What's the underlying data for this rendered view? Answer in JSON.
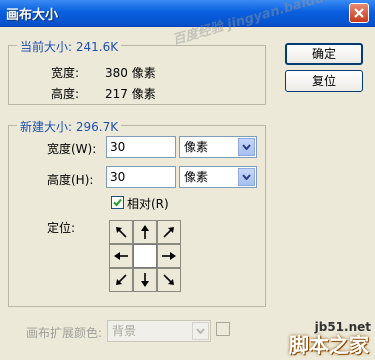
{
  "window": {
    "title": "画布大小"
  },
  "watermark": "百度经验 jingyan.baidu.com",
  "current_size": {
    "legend": "当前大小: 241.6K",
    "width_label": "宽度:",
    "width_value": "380 像素",
    "height_label": "高度:",
    "height_value": "217 像素"
  },
  "new_size": {
    "legend": "新建大小: 296.7K",
    "width_label": "宽度(W):",
    "width_value": "30",
    "width_unit": "像素",
    "height_label": "高度(H):",
    "height_value": "30",
    "height_unit": "像素",
    "relative_label": "相对(R)",
    "relative_checked": true,
    "anchor_label": "定位:"
  },
  "buttons": {
    "ok": "确定",
    "reset": "复位"
  },
  "extension": {
    "label": "画布扩展颜色:",
    "value": "背景"
  },
  "site": {
    "domain": "jb51.net",
    "name": "脚本之家"
  }
}
